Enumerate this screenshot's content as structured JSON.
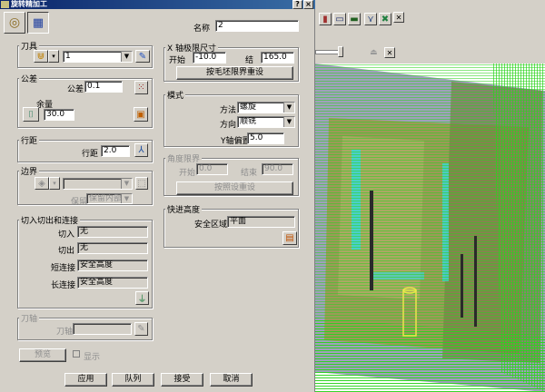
{
  "title": "旋转精加工",
  "name_label": "名称",
  "name_value": "2",
  "tool": {
    "group_label": "刀具",
    "value": "1"
  },
  "tolerance": {
    "group_label": "公差",
    "tol_label": "公差",
    "tol_value": "0.1",
    "thick_label": "余量",
    "thick_value": "30.0"
  },
  "stepover": {
    "group_label": "行距",
    "label": "行距",
    "value": "2.0"
  },
  "boundary": {
    "group_label": "边界",
    "keep_label": "保留",
    "keep_value": "保留内部"
  },
  "leads": {
    "group_label": "切入切出和连接",
    "rows": [
      {
        "label": "切入",
        "value": "无"
      },
      {
        "label": "切出",
        "value": "无"
      },
      {
        "label": "短连接",
        "value": "安全高度"
      },
      {
        "label": "长连接",
        "value": "安全高度"
      }
    ]
  },
  "axis": {
    "group_label": "刀轴",
    "label": "刀轴"
  },
  "preview": {
    "button": "预览",
    "check_label": "显示"
  },
  "xlimits": {
    "group_label": "X 轴极限尺寸",
    "start_label": "开始",
    "start_value": "-10.0",
    "end_label": "结",
    "end_value": "165.0",
    "reset_button": "按毛坯限界重设"
  },
  "style": {
    "group_label": "模式",
    "method_label": "方法",
    "method_value": "螺旋",
    "direction_label": "方向",
    "direction_value": "顺铣",
    "yoffset_label": "Y轴偏置",
    "yoffset_value": "5.0"
  },
  "angle": {
    "group_label": "角度限界",
    "start_label": "开始",
    "start_value": "0.0",
    "end_label": "结束",
    "end_value": "90.0",
    "reset_button": "按照设重设"
  },
  "rapid": {
    "group_label": "快进高度",
    "safe_label": "安全区域",
    "safe_value": "平面"
  },
  "buttons": {
    "apply": "应用",
    "queue": "队列",
    "accept": "接受",
    "cancel": "取消"
  },
  "colors": {
    "toolpath": "#2cd31e",
    "part": "#9c9a58",
    "highlight": "#3fd4d4"
  }
}
